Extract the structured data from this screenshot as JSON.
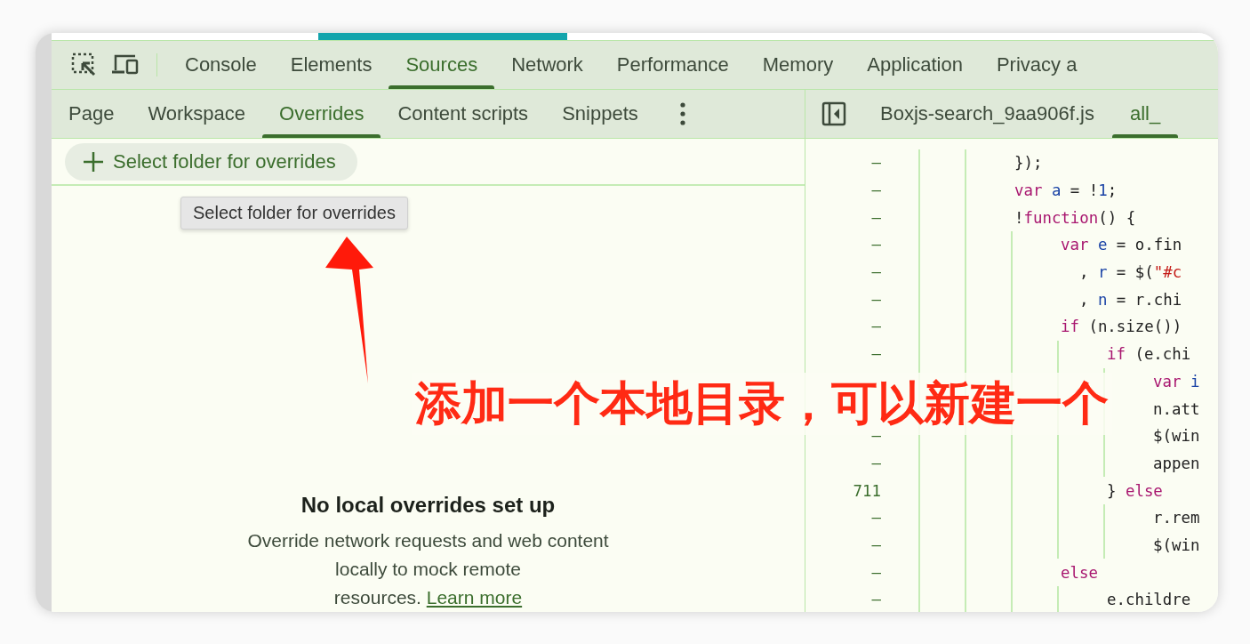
{
  "main_tabs": [
    {
      "label": "Console",
      "selected": false
    },
    {
      "label": "Elements",
      "selected": false
    },
    {
      "label": "Sources",
      "selected": true
    },
    {
      "label": "Network",
      "selected": false
    },
    {
      "label": "Performance",
      "selected": false
    },
    {
      "label": "Memory",
      "selected": false
    },
    {
      "label": "Application",
      "selected": false
    },
    {
      "label": "Privacy a",
      "selected": false
    }
  ],
  "navigator": {
    "tabs": [
      {
        "label": "Page",
        "selected": false
      },
      {
        "label": "Workspace",
        "selected": false
      },
      {
        "label": "Overrides",
        "selected": true
      },
      {
        "label": "Content scripts",
        "selected": false
      },
      {
        "label": "Snippets",
        "selected": false
      }
    ],
    "button": "Select folder for overrides",
    "tooltip": "Select folder for overrides",
    "empty_state": {
      "title": "No local overrides set up",
      "description_lines": [
        "Override network requests and web content",
        "locally to mock remote",
        "resources."
      ],
      "link": "Learn more"
    }
  },
  "editor": {
    "tabs": [
      {
        "label": "Boxjs-search_9aa906f.js",
        "selected": false
      },
      {
        "label": "all_",
        "selected": true
      }
    ],
    "lines": [
      {
        "number": "–",
        "tokens": [
          {
            "kind": "plain",
            "text": "});"
          }
        ]
      },
      {
        "number": "–",
        "tokens": [
          {
            "kind": "keyword",
            "text": "var"
          },
          {
            "kind": "variable",
            "text": " a"
          },
          {
            "kind": "plain",
            "text": " = !"
          },
          {
            "kind": "number",
            "text": "1"
          },
          {
            "kind": "plain",
            "text": ";"
          }
        ]
      },
      {
        "number": "–",
        "tokens": [
          {
            "kind": "plain",
            "text": "!"
          },
          {
            "kind": "keyword",
            "text": "function"
          },
          {
            "kind": "plain",
            "text": "() {"
          }
        ],
        "children": [
          {
            "number": "–",
            "tokens": [
              {
                "kind": "keyword",
                "text": "var"
              },
              {
                "kind": "variable",
                "text": " e"
              },
              {
                "kind": "plain",
                "text": " = o.fin"
              }
            ]
          },
          {
            "number": "–",
            "tokens": [
              {
                "kind": "plain",
                "text": "  , "
              },
              {
                "kind": "variable",
                "text": "r"
              },
              {
                "kind": "plain",
                "text": " = $("
              },
              {
                "kind": "string",
                "text": "\"#c"
              }
            ]
          },
          {
            "number": "–",
            "tokens": [
              {
                "kind": "plain",
                "text": "  , "
              },
              {
                "kind": "variable",
                "text": "n"
              },
              {
                "kind": "plain",
                "text": " = r.chi"
              }
            ]
          },
          {
            "number": "–",
            "tokens": [
              {
                "kind": "keyword",
                "text": "if"
              },
              {
                "kind": "plain",
                "text": " (n.size())"
              }
            ],
            "children": [
              {
                "number": "–",
                "tokens": [
                  {
                    "kind": "keyword",
                    "text": "if"
                  },
                  {
                    "kind": "plain",
                    "text": " (e.chi"
                  }
                ],
                "children": [
                  {
                    "tokens": [
                      {
                        "kind": "keyword",
                        "text": "var"
                      },
                      {
                        "kind": "variable",
                        "text": " i"
                      }
                    ]
                  },
                  {
                    "tokens": [
                      {
                        "kind": "plain",
                        "text": "n.att"
                      }
                    ]
                  },
                  {
                    "number": "–",
                    "tokens": [
                      {
                        "kind": "plain",
                        "text": "$(win"
                      }
                    ]
                  },
                  {
                    "number": "–",
                    "tokens": [
                      {
                        "kind": "plain",
                        "text": "appen"
                      }
                    ]
                  }
                ]
              },
              {
                "number": "711",
                "tokens": [
                  {
                    "kind": "plain",
                    "text": "} "
                  },
                  {
                    "kind": "keyword",
                    "text": "else"
                  }
                ],
                "children": [
                  {
                    "number": "–",
                    "tokens": [
                      {
                        "kind": "plain",
                        "text": "r.rem"
                      }
                    ]
                  },
                  {
                    "number": "–",
                    "tokens": [
                      {
                        "kind": "plain",
                        "text": "$(win"
                      }
                    ]
                  }
                ]
              }
            ]
          },
          {
            "number": "–",
            "tokens": [
              {
                "kind": "keyword",
                "text": "else"
              }
            ],
            "children": [
              {
                "number": "–",
                "tokens": [
                  {
                    "kind": "plain",
                    "text": "e.childre"
                  }
                ]
              }
            ]
          }
        ]
      }
    ]
  },
  "annotation": {
    "text": "添加一个本地目录，可以新建一个"
  }
}
